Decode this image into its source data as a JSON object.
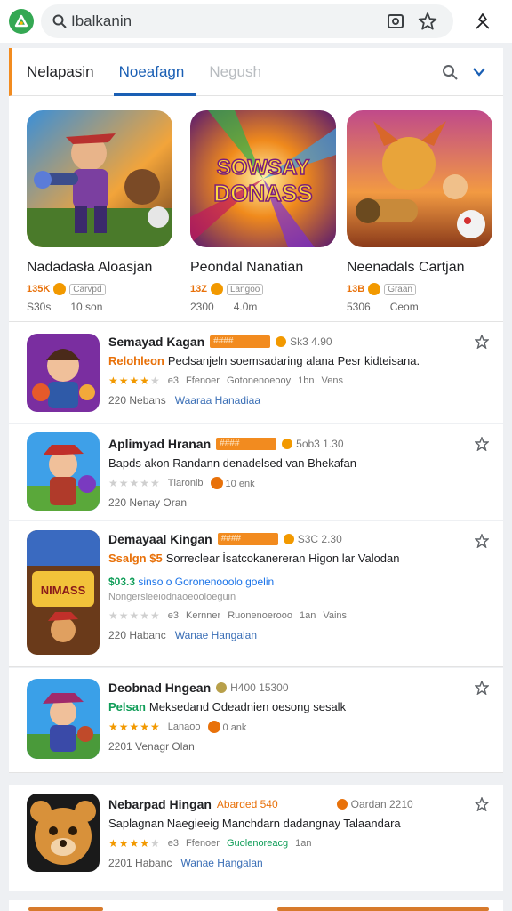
{
  "search": {
    "value": "Ibalkanin"
  },
  "tabs": [
    {
      "label": "Nelapasin"
    },
    {
      "label": "Noeafagn"
    },
    {
      "label": "Negush"
    }
  ],
  "featured": [
    {
      "title": "Nadadasła Aloasjan",
      "badge": "135K",
      "box": "Carvpd",
      "meta1": "S30s",
      "meta2": "10 son",
      "art_text": ""
    },
    {
      "title": "Peondal Nanatian",
      "badge": "13Z",
      "box": "Langoo",
      "meta1": "2300",
      "meta2": "4.0m",
      "art_text": "SOWSAY DONASS"
    },
    {
      "title": "Neenadals Cartjan",
      "badge": "13B",
      "box": "Graan",
      "meta1": "5306",
      "meta2": "Ceom",
      "art_text": ""
    }
  ],
  "list": [
    {
      "name": "Semayad Kagan",
      "pill": "####",
      "score": "Sk3 4.90",
      "tag": "Relohleon",
      "desc": "Peclsanjeln soemsadaring alana Pesr kidteisana.",
      "rating_a": "e3",
      "rating_b": "Ffenoer",
      "rating_c": "Gotonenoeooy",
      "rating_d": "1bn",
      "rating_e": "Vens",
      "meta": "220 Nebans",
      "meta_blue": "Waaraa Hanadiaa",
      "stars": 4
    },
    {
      "name": "Aplimyad Hranan",
      "pill": "####",
      "score": "5ob3 1.30",
      "tag": "",
      "desc": "Bapds akon Randann denadelsed van Bhekafan",
      "rating_a": "Tlaronib",
      "rating_b": "10 enk",
      "meta": "220 Nenay Oran",
      "meta_blue": "",
      "stars": 0
    },
    {
      "name": "Demayaal Kingan",
      "pill": "####",
      "score": "S3C 2.30",
      "tag": "Ssalgn $5",
      "desc": "Sorreclear İsatcokanereran Higon lar Valodan",
      "extra_green": "$03.3",
      "extra": "sinso o Goronenooolo goelin",
      "extra2": "Nongersleeiodnaoeooloeguin",
      "rating_a": "e3",
      "rating_b": "Kernner",
      "rating_c": "Ruonenoerooo",
      "rating_d": "1an",
      "rating_e": "Vains",
      "meta": "220 Habanc",
      "meta_blue": "Wanae Hangalan",
      "stars": 0
    },
    {
      "name": "Deobnad Hngean",
      "pill": "",
      "score": "H400 15300",
      "tag": "Pelsan",
      "desc": "Meksedand Odeadnien oesong sesalk",
      "rating_a": "Lanaoo",
      "rating_b": "0 ank",
      "meta": "2201 Venagr Olan",
      "meta_blue": "",
      "stars": 5
    },
    {
      "name": "Nebarpad Hingan",
      "pill": "Abarded 540",
      "score": "Oardan 2210",
      "tag": "",
      "desc": "Saplagnan Naegieeig Manchdarn dadangnay Talaandara",
      "rating_a": "e3",
      "rating_b": "Ffenoer",
      "rating_c": "Guolenoreacg",
      "rating_d": "1an",
      "rating_e": "",
      "meta": "2201 Habanc",
      "meta_blue": "Wanae Hangalan",
      "stars": 4
    }
  ]
}
